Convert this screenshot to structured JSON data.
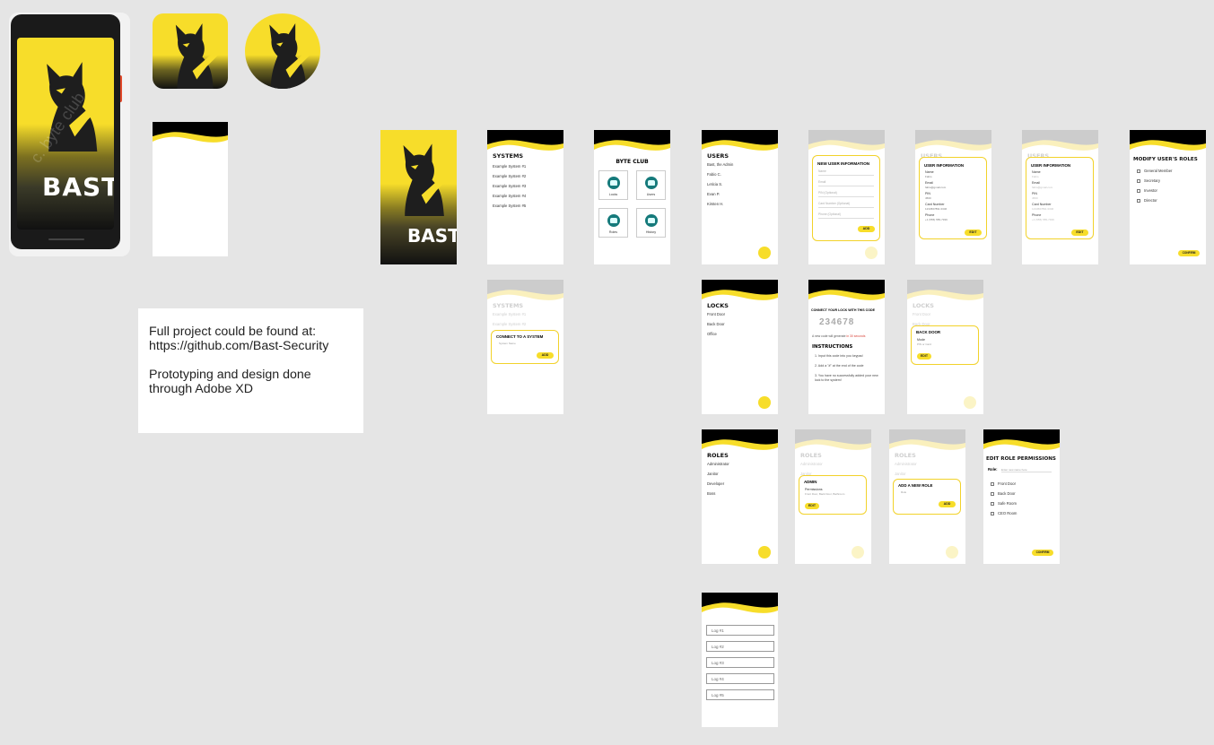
{
  "colors": {
    "yellow": "#f7dd2a",
    "black": "#000000",
    "teal": "#157a7b",
    "canvas": "#e5e5e5"
  },
  "phone": {
    "brand": "BAST",
    "watermark": "c. byte club"
  },
  "splash": {
    "brand": "BAST"
  },
  "note": {
    "line1": "Full project could be found at:",
    "line2": "https://github.com/Bast-Security",
    "line3": "Prototyping and design done",
    "line4": "through Adobe XD"
  },
  "systems": {
    "title": "SYSTEMS",
    "items": [
      "Example System #1",
      "Example System #2",
      "Example System #3",
      "Example System #4",
      "Example System #5"
    ]
  },
  "dashboard": {
    "title": "BYTE CLUB",
    "tiles": [
      "Locks",
      "Users",
      "Roles",
      "History"
    ]
  },
  "users": {
    "title": "USERS",
    "items": [
      "Bast, the Admin",
      "Fabio C.",
      "Leticia S.",
      "Evan P.",
      "Kirsten H."
    ]
  },
  "new_user": {
    "title": "NEW USER INFORMATION",
    "fields": [
      "Name",
      "Email",
      "PIN (Optional)",
      "Card Number (Optional)",
      "Phone (Optional)"
    ],
    "button": "ADD"
  },
  "user_info": {
    "bg_title": "USERS",
    "title": "USER INFORMATION",
    "rows": [
      {
        "label": "Name",
        "value": "Fabio"
      },
      {
        "label": "Email",
        "value": "fabio@gmail.com"
      },
      {
        "label": "PIN",
        "value": "4560"
      },
      {
        "label": "Card Number",
        "value": "1234567891 0346"
      },
      {
        "label": "Phone",
        "value": "+1 (555) 555-7339"
      }
    ],
    "button": "EDIT"
  },
  "modify_roles": {
    "title": "MODIFY USER'S ROLES",
    "items": [
      "General Member",
      "Secretary",
      "Investor",
      "Director"
    ],
    "button": "CONFIRM"
  },
  "connect_system": {
    "bg_title": "SYSTEMS",
    "bg_items": [
      "Example System #1",
      "Example System #2"
    ],
    "title": "CONNECT TO A SYSTEM",
    "placeholder": "System Name",
    "button": "ADD"
  },
  "locks": {
    "title": "LOCKS",
    "items": [
      "Front Door",
      "Back Door",
      "Office"
    ]
  },
  "connect_lock": {
    "heading": "CONNECT YOUR LOCK WITH THIS CODE",
    "code": "234678",
    "timer_text": "A new code will generate",
    "timer_value": "in 30 seconds",
    "instructions_title": "INSTRUCTIONS",
    "steps": [
      "1. Input this code into you keypad",
      "2. Add a \"#\" at the end of the code",
      "3. You have no successfully added your new lock to the system!"
    ]
  },
  "lock_info": {
    "bg_title": "LOCKS",
    "bg_items": [
      "Front Door",
      "Back Door"
    ],
    "title": "BACK DOOR",
    "label": "Mode",
    "value": "PIN or Card",
    "button": "EDIT"
  },
  "roles": {
    "title": "ROLES",
    "items": [
      "Administrator",
      "Janitor",
      "Developer",
      "Boss"
    ]
  },
  "role_info": {
    "bg_title": "ROLES",
    "bg_items": [
      "Administrator",
      "Janitor"
    ],
    "title": "ADMIN",
    "label": "Permissions",
    "value": "Front Door, Back Door, Bathroom",
    "button": "EDIT"
  },
  "new_role": {
    "bg_title": "ROLES",
    "bg_items": [
      "Administrator",
      "Janitor"
    ],
    "title": "ADD A NEW ROLE",
    "placeholder": "Role",
    "button": "ADD"
  },
  "edit_role": {
    "title": "EDIT ROLE PERMISSIONS",
    "role_label": "Role:",
    "role_placeholder": "Enter new name here",
    "items": [
      "Front Door",
      "Back Door",
      "Safe Room",
      "CEO Room"
    ],
    "button": "CONFIRM"
  },
  "history": {
    "logs": [
      "Log #1",
      "Log #2",
      "Log #3",
      "Log #4",
      "Log #5"
    ]
  }
}
